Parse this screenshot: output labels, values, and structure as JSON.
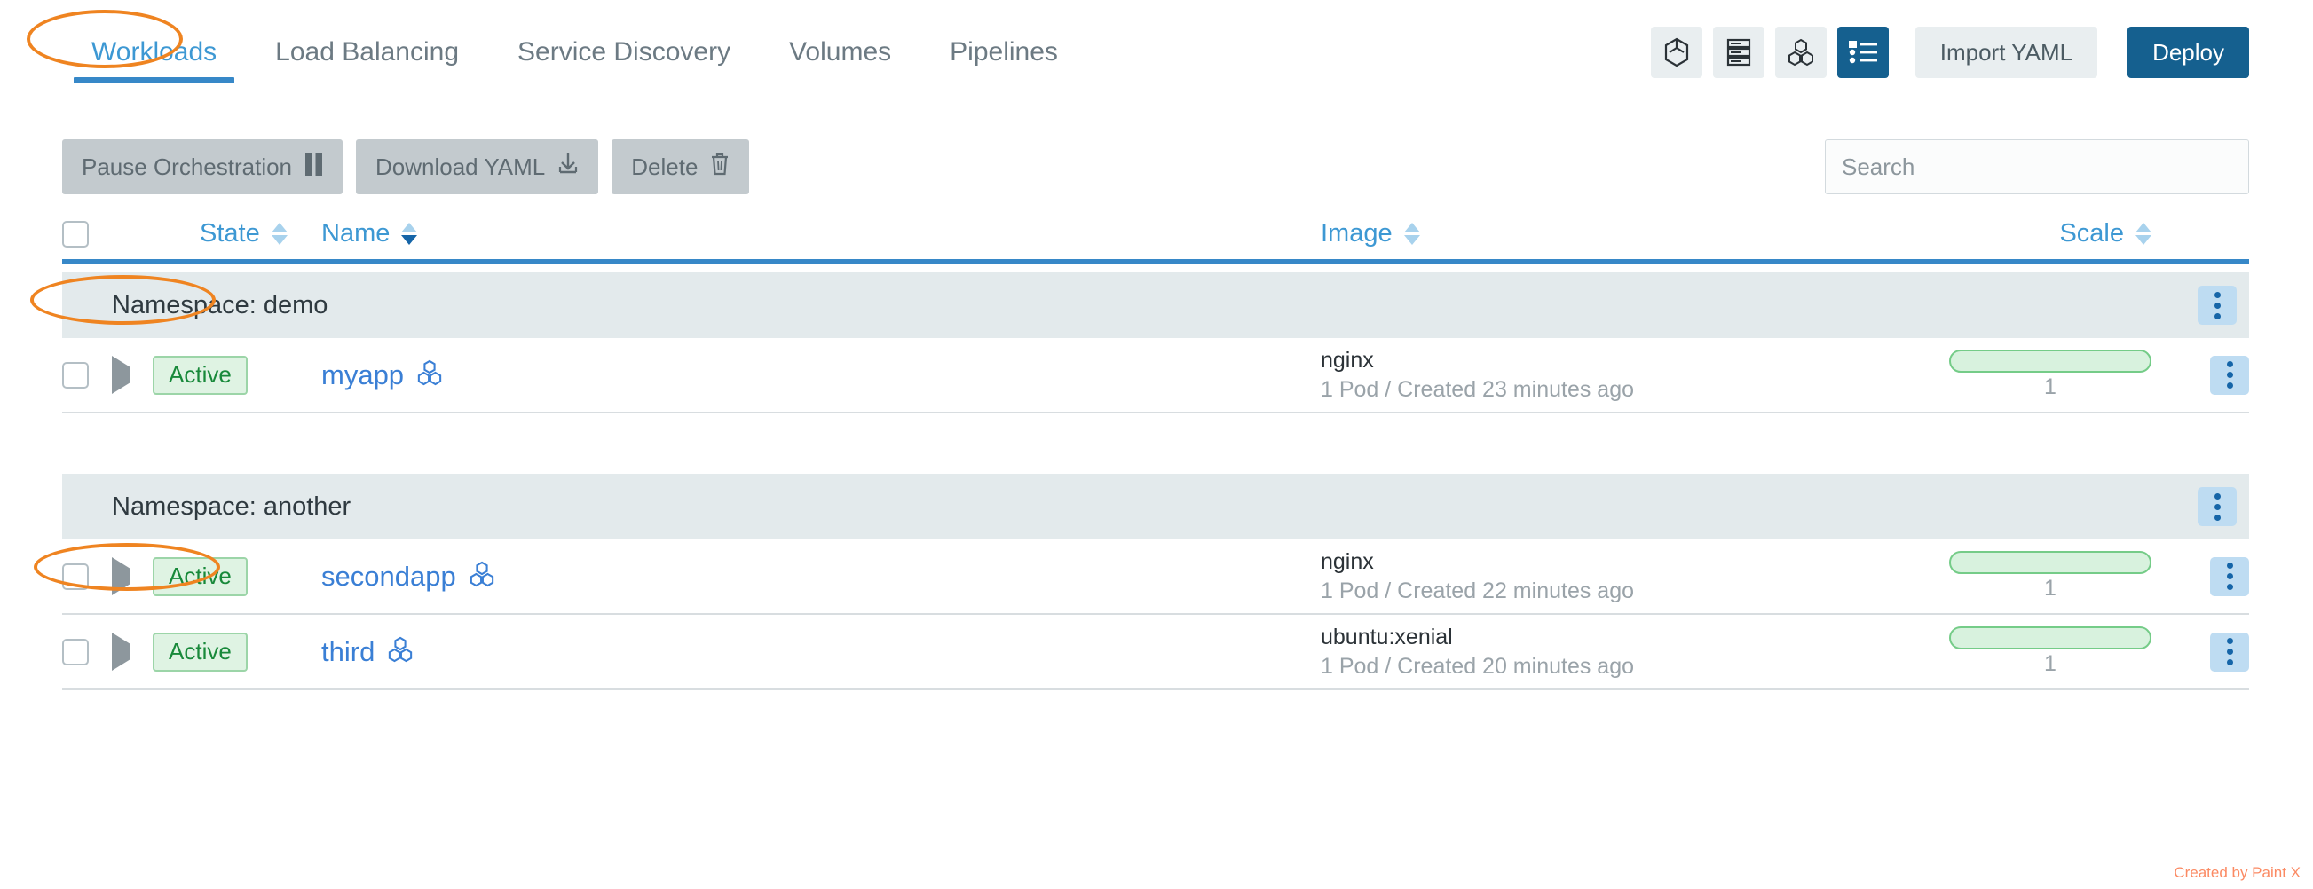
{
  "nav": {
    "tabs": [
      {
        "label": "Workloads",
        "active": true
      },
      {
        "label": "Load Balancing",
        "active": false
      },
      {
        "label": "Service Discovery",
        "active": false
      },
      {
        "label": "Volumes",
        "active": false
      },
      {
        "label": "Pipelines",
        "active": false
      }
    ],
    "view_icons": [
      {
        "name": "cube-icon",
        "selected": false
      },
      {
        "name": "server-stack-icon",
        "selected": false
      },
      {
        "name": "cluster-icon",
        "selected": false
      },
      {
        "name": "list-view-icon",
        "selected": true
      }
    ],
    "import_yaml_label": "Import YAML",
    "deploy_label": "Deploy"
  },
  "toolbar": {
    "pause_label": "Pause Orchestration",
    "pause_icon": "pause-icon",
    "download_label": "Download YAML",
    "download_icon": "download-icon",
    "delete_label": "Delete",
    "delete_icon": "trash-icon"
  },
  "search": {
    "placeholder": "Search",
    "value": ""
  },
  "table": {
    "headers": {
      "state": "State",
      "name": "Name",
      "image": "Image",
      "scale": "Scale"
    },
    "sort": {
      "column": "Name",
      "direction": "desc"
    },
    "groups": [
      {
        "label": "Namespace: demo",
        "rows": [
          {
            "state": "Active",
            "name": "myapp",
            "image": "nginx",
            "image_sub": "1 Pod / Created 23 minutes ago",
            "scale": "1"
          }
        ]
      },
      {
        "label": "Namespace: another",
        "rows": [
          {
            "state": "Active",
            "name": "secondapp",
            "image": "nginx",
            "image_sub": "1 Pod / Created 22 minutes ago",
            "scale": "1"
          },
          {
            "state": "Active",
            "name": "third",
            "image": "ubuntu:xenial",
            "image_sub": "1 Pod / Created 20 minutes ago",
            "scale": "1"
          }
        ]
      }
    ]
  },
  "annotations": {
    "highlight_color": "#ef8421",
    "items": [
      "Workloads",
      "Namespace: demo",
      "Namespace: another"
    ]
  },
  "watermark": {
    "text": "Created by Paint X"
  },
  "colors": {
    "accent_blue": "#3788c8",
    "primary_blue": "#15608f",
    "link_blue": "#3a7fd5",
    "active_green": "#18893a",
    "group_bg": "#e3eaec"
  }
}
